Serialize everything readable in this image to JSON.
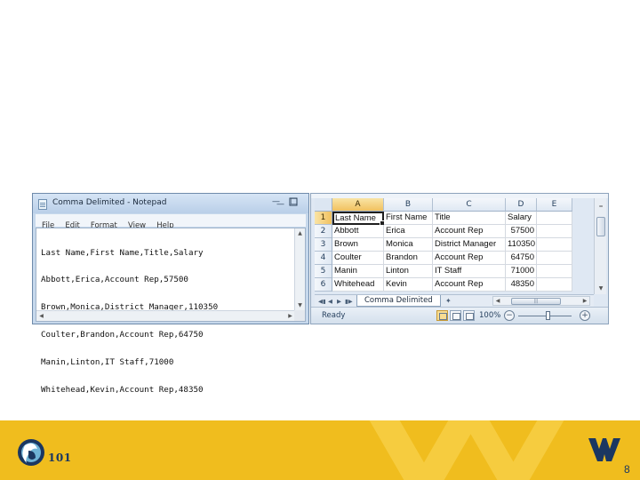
{
  "notepad": {
    "title": "Comma Delimited - Notepad",
    "menu": [
      "File",
      "Edit",
      "Format",
      "View",
      "Help"
    ],
    "lines": [
      "Last Name,First Name,Title,Salary",
      "Abbott,Erica,Account Rep,57500",
      "Brown,Monica,District Manager,110350",
      "Coulter,Brandon,Account Rep,64750",
      "Manin,Linton,IT Staff,71000",
      "Whitehead,Kevin,Account Rep,48350"
    ]
  },
  "excel": {
    "columns": [
      "A",
      "B",
      "C",
      "D",
      "E"
    ],
    "row_numbers": [
      "1",
      "2",
      "3",
      "4",
      "5",
      "6"
    ],
    "rows": [
      [
        "Last Name",
        "First Name",
        "Title",
        "Salary"
      ],
      [
        "Abbott",
        "Erica",
        "Account Rep",
        "57500"
      ],
      [
        "Brown",
        "Monica",
        "District Manager",
        "110350"
      ],
      [
        "Coulter",
        "Brandon",
        "Account Rep",
        "64750"
      ],
      [
        "Manin",
        "Linton",
        "IT Staff",
        "71000"
      ],
      [
        "Whitehead",
        "Kevin",
        "Account Rep",
        "48350"
      ]
    ],
    "active_cell": "A1",
    "sheet_tab": "Comma Delimited",
    "status": "Ready",
    "zoom": "100%"
  },
  "footer": {
    "logo_text": "101",
    "page_number": "8",
    "band_color": "#f0bd1e",
    "navy": "#1b3761"
  }
}
